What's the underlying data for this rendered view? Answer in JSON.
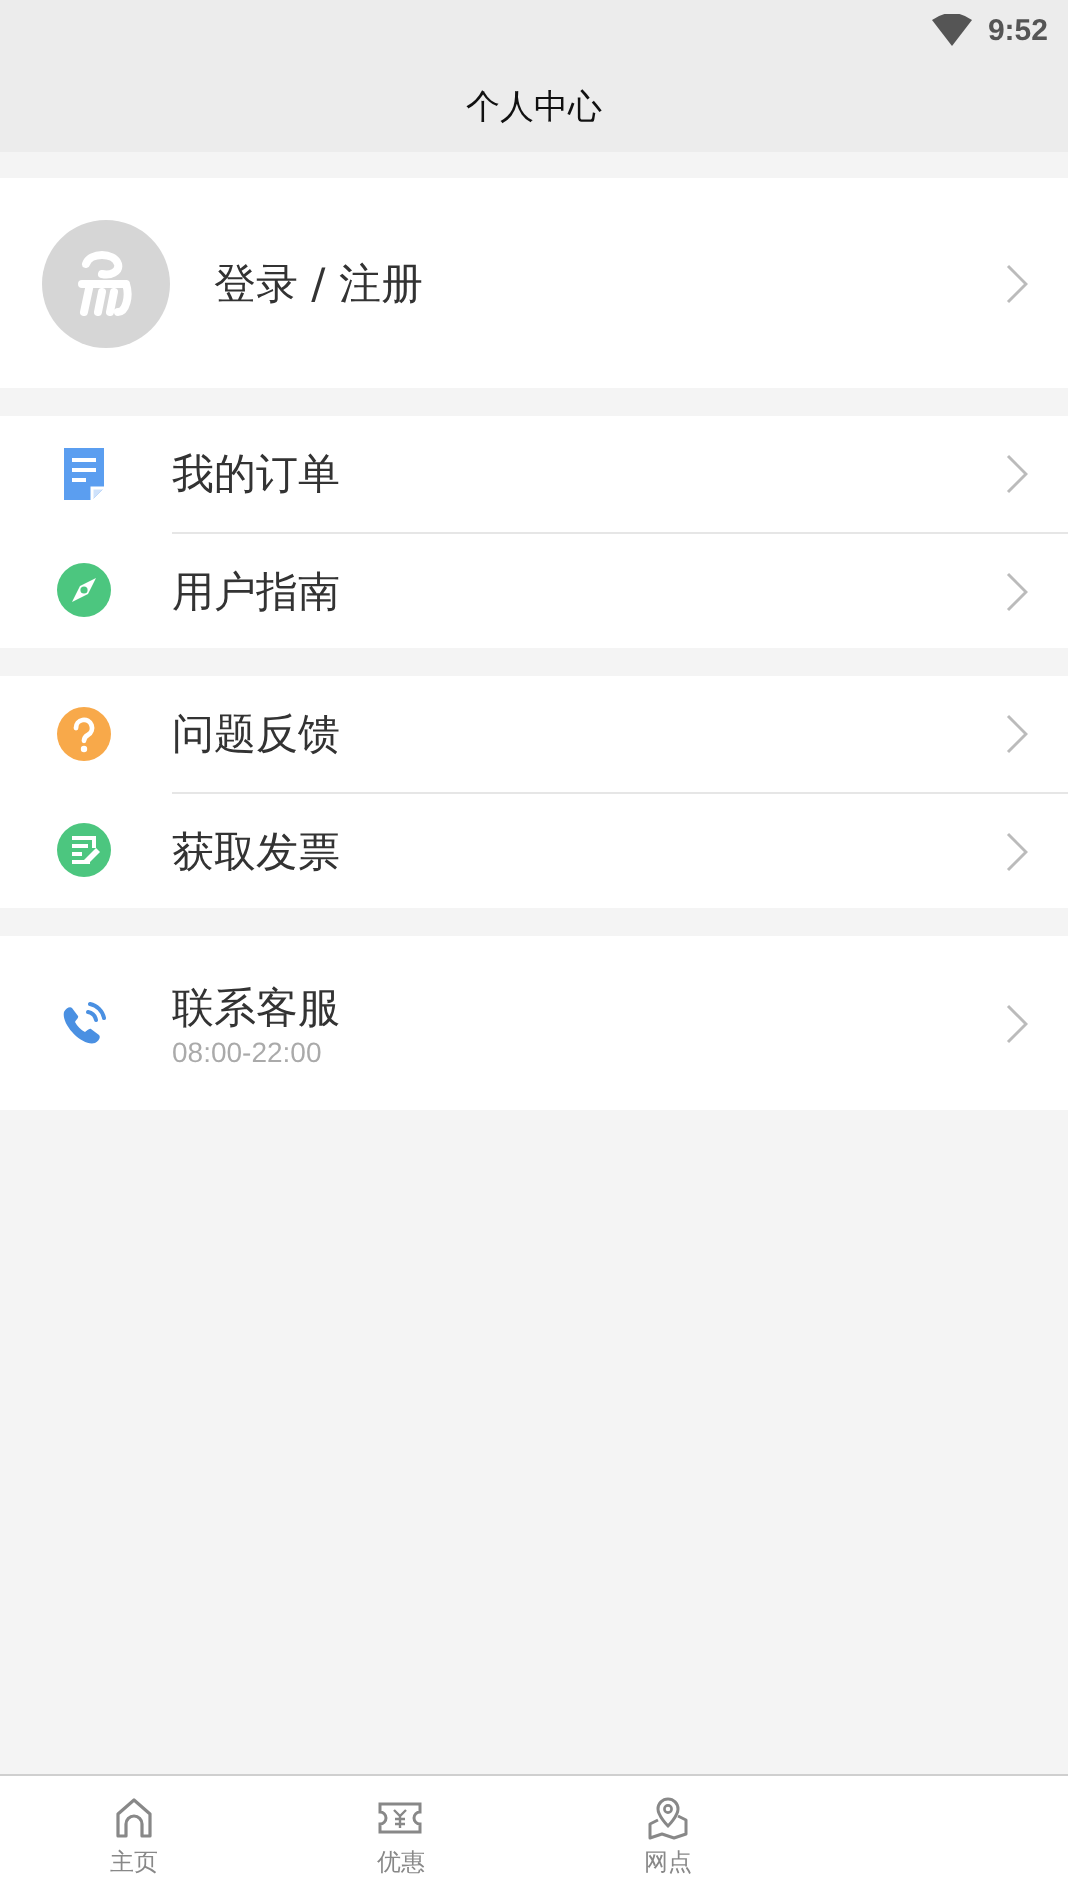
{
  "status_bar": {
    "time": "9:52"
  },
  "header": {
    "title": "个人中心"
  },
  "profile": {
    "label": "登录 / 注册"
  },
  "groups": [
    {
      "items": [
        {
          "kind": "order",
          "label": "我的订单"
        },
        {
          "kind": "guide",
          "label": "用户指南"
        }
      ]
    },
    {
      "items": [
        {
          "kind": "feedback",
          "label": "问题反馈"
        },
        {
          "kind": "invoice",
          "label": "获取发票"
        }
      ]
    },
    {
      "items": [
        {
          "kind": "phone",
          "label": "联系客服",
          "subtitle": "08:00-22:00"
        }
      ]
    }
  ],
  "tab_bar": [
    {
      "kind": "home",
      "label": "主页",
      "selected": false
    },
    {
      "kind": "coupon",
      "label": "优惠",
      "selected": false
    },
    {
      "kind": "location",
      "label": "网点",
      "selected": false
    }
  ]
}
